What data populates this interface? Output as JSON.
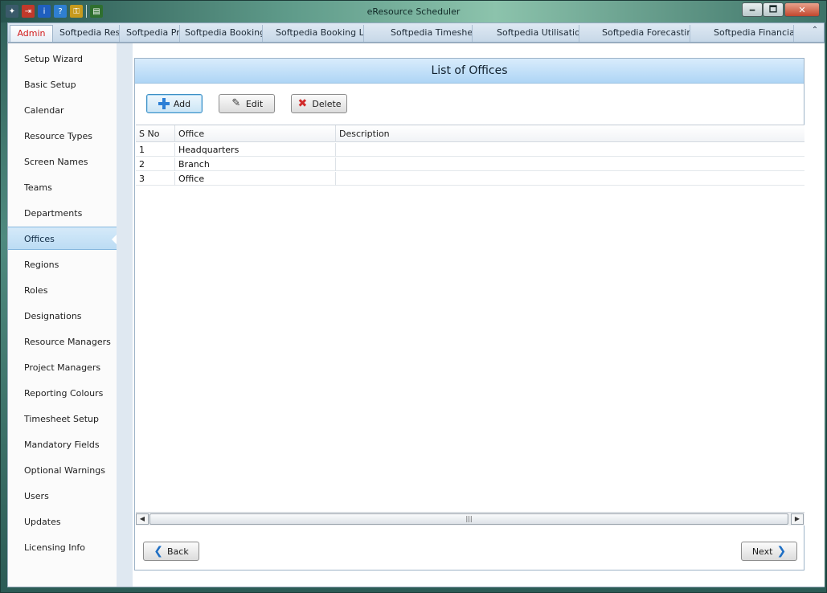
{
  "window": {
    "title": "eResource Scheduler",
    "min_glyph": "🗕",
    "max_glyph": "🗖",
    "close_glyph": "✕"
  },
  "quick_access": [
    {
      "name": "pin-icon",
      "glyph": "✦"
    },
    {
      "name": "exit-icon",
      "glyph": "⇥"
    },
    {
      "name": "info-icon",
      "glyph": "i"
    },
    {
      "name": "help-icon",
      "glyph": "?"
    },
    {
      "name": "key-icon",
      "glyph": "⚿"
    },
    {
      "name": "chart-icon",
      "glyph": "▤"
    }
  ],
  "tabs": [
    {
      "label": "Admin"
    },
    {
      "label": "Softpedia Reso"
    },
    {
      "label": "Softpedia Pr"
    },
    {
      "label": "Softpedia Booking"
    },
    {
      "label": "Softpedia Booking List"
    },
    {
      "label": "Softpedia Timesheet"
    },
    {
      "label": "Softpedia Utilisation"
    },
    {
      "label": "Softpedia Forecasting"
    },
    {
      "label": "Softpedia Financials"
    }
  ],
  "tab_scroll_glyph": "⌃",
  "sidebar": {
    "items": [
      {
        "label": "Setup Wizard"
      },
      {
        "label": "Basic Setup"
      },
      {
        "label": "Calendar"
      },
      {
        "label": "Resource Types"
      },
      {
        "label": "Screen Names"
      },
      {
        "label": "Teams"
      },
      {
        "label": "Departments"
      },
      {
        "label": "Offices"
      },
      {
        "label": "Regions"
      },
      {
        "label": "Roles"
      },
      {
        "label": "Designations"
      },
      {
        "label": "Resource Managers"
      },
      {
        "label": "Project Managers"
      },
      {
        "label": "Reporting Colours"
      },
      {
        "label": "Timesheet Setup"
      },
      {
        "label": "Mandatory Fields"
      },
      {
        "label": "Optional Warnings"
      },
      {
        "label": "Users"
      },
      {
        "label": "Updates"
      },
      {
        "label": "Licensing Info"
      }
    ],
    "selected": "Offices"
  },
  "panel": {
    "title": "List of Offices",
    "add_label": "Add",
    "edit_label": "Edit",
    "delete_label": "Delete",
    "back_label": "Back",
    "next_label": "Next"
  },
  "grid": {
    "columns": [
      "S No",
      "Office",
      "Description"
    ],
    "rows": [
      [
        "1",
        "Headquarters",
        ""
      ],
      [
        "2",
        "Branch",
        ""
      ],
      [
        "3",
        "Office",
        ""
      ]
    ],
    "scroll_left_glyph": "◀",
    "scroll_right_glyph": "▶",
    "thumb_glyph": "|||"
  }
}
